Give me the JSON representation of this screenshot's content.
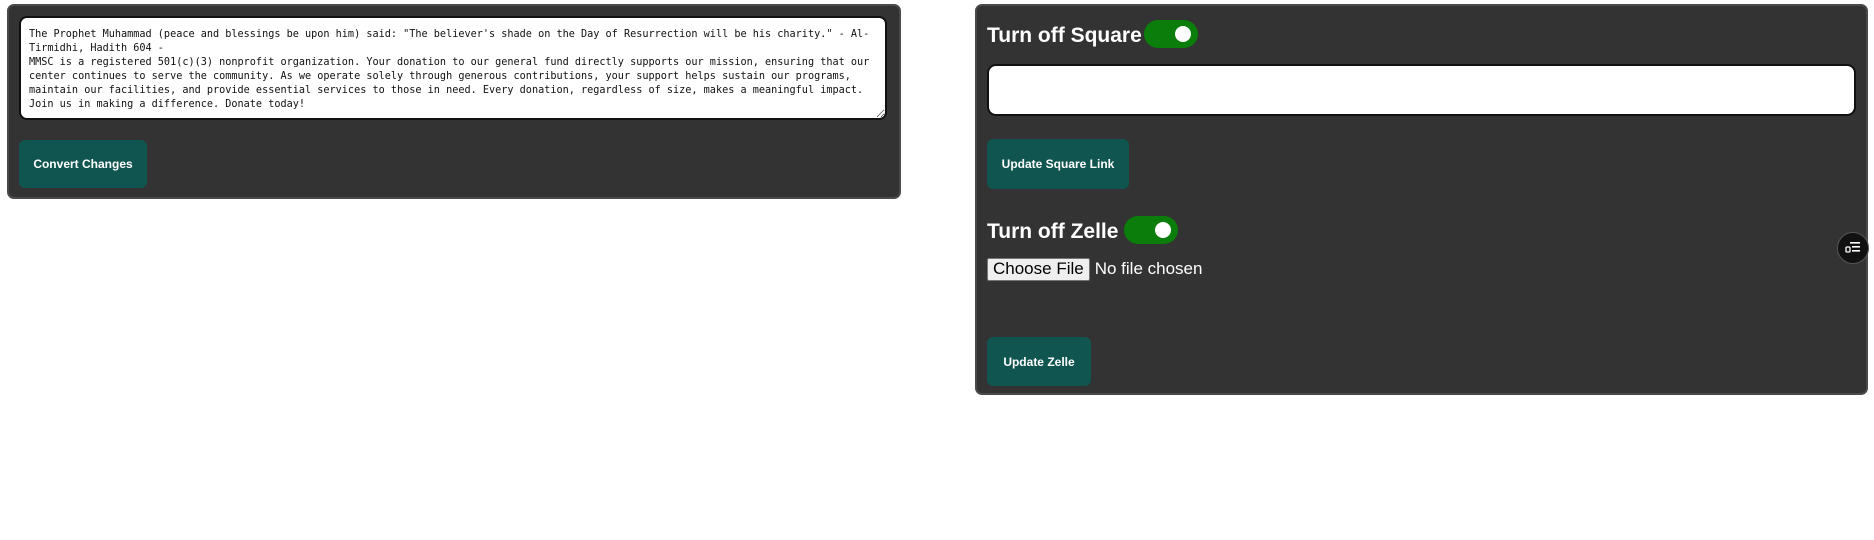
{
  "announcement": {
    "text": "The Prophet Muhammad (peace and blessings be upon him) said: \"The believer's shade on the Day of Resurrection will be his charity.\" - Al-Tirmidhi, Hadith 604 -\nMMSC is a registered 501(c)(3) nonprofit organization. Your donation to our general fund directly supports our mission, ensuring that our center continues to serve the community. As we operate solely through generous contributions, your support helps sustain our programs, maintain our facilities, and provide essential services to those in need. Every donation, regardless of size, makes a meaningful impact. Join us in making a difference. Donate today!",
    "convert_label": "Convert Changes"
  },
  "square": {
    "heading": "Turn off Square",
    "toggle_on": true,
    "link_value": "",
    "update_label": "Update Square Link"
  },
  "zelle": {
    "heading": "Turn off Zelle",
    "toggle_on": true,
    "choose_file_label": "Choose File",
    "file_status": "No file chosen",
    "update_label": "Update Zelle"
  },
  "colors": {
    "panel_bg": "#333333",
    "button_bg": "#115550",
    "toggle_on": "#0a7d0a"
  },
  "floating_widget": {
    "icon": "menu-list-icon"
  }
}
